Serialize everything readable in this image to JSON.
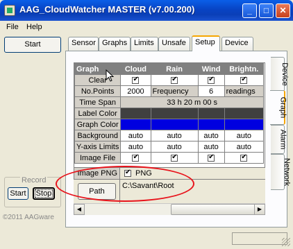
{
  "window": {
    "title": "AAG_CloudWatcher MASTER (v7.00.200)",
    "minimize": "_",
    "maximize": "□",
    "close": "✕"
  },
  "menu": {
    "file": "File",
    "help": "Help"
  },
  "left": {
    "start": "Start",
    "record_label": "Record",
    "record_start": "Start",
    "record_stop": "Stop",
    "copyright": "©2011 AAGware"
  },
  "tabs": [
    "Sensor",
    "Graphs",
    "Limits",
    "Unsafe",
    "Setup",
    "Device"
  ],
  "active_tab": "Setup",
  "side_tabs": [
    "Device",
    "Graph",
    "Alarm",
    "Network"
  ],
  "active_side_tab": "Graph",
  "grid": {
    "headers": [
      "Graph",
      "Cloud",
      "Rain",
      "Wind",
      "Brightn."
    ],
    "clear_label": "Clear",
    "points_label": "No.Points",
    "points_value": "2000",
    "frequency_label": "Frequency",
    "frequency_value": "6",
    "readings_label": "readings",
    "timespan_label": "Time Span",
    "timespan_value": "33 h 20 m 00 s",
    "label_color": "Label Color",
    "graph_color": "Graph Color",
    "background_label": "Background",
    "yaxis_label": "Y-axis Limits",
    "auto": "auto",
    "image_file_label": "Image File",
    "image_png_label": "Image PNG",
    "png_checkbox_label": "PNG",
    "path_button": "Path",
    "path_value": "C:\\Savant\\Root",
    "colors": {
      "label": "#404040",
      "graph": "#0000e0"
    }
  }
}
